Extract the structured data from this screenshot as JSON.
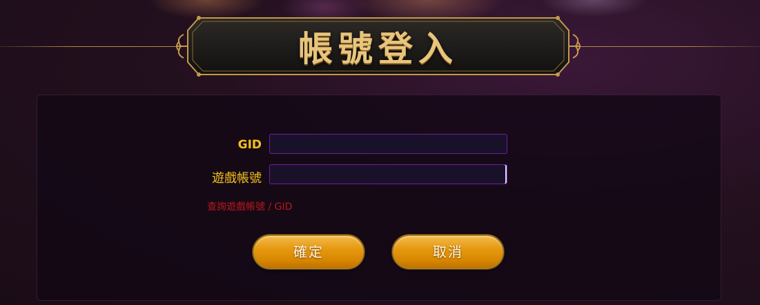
{
  "header": {
    "title": "帳號登入"
  },
  "form": {
    "gid_label": "GID",
    "gid_value": "",
    "account_label": "遊戲帳號",
    "account_value": "",
    "lookup_link": "查詢遊戲帳號 / GID"
  },
  "buttons": {
    "confirm_label": "確定",
    "cancel_label": "取消"
  },
  "colors": {
    "accent_gold": "#e8c57c",
    "label_yellow": "#f3c01c",
    "link_red": "#b8191b",
    "button_orange": "#e59a10",
    "input_border": "#6c1f9e"
  }
}
